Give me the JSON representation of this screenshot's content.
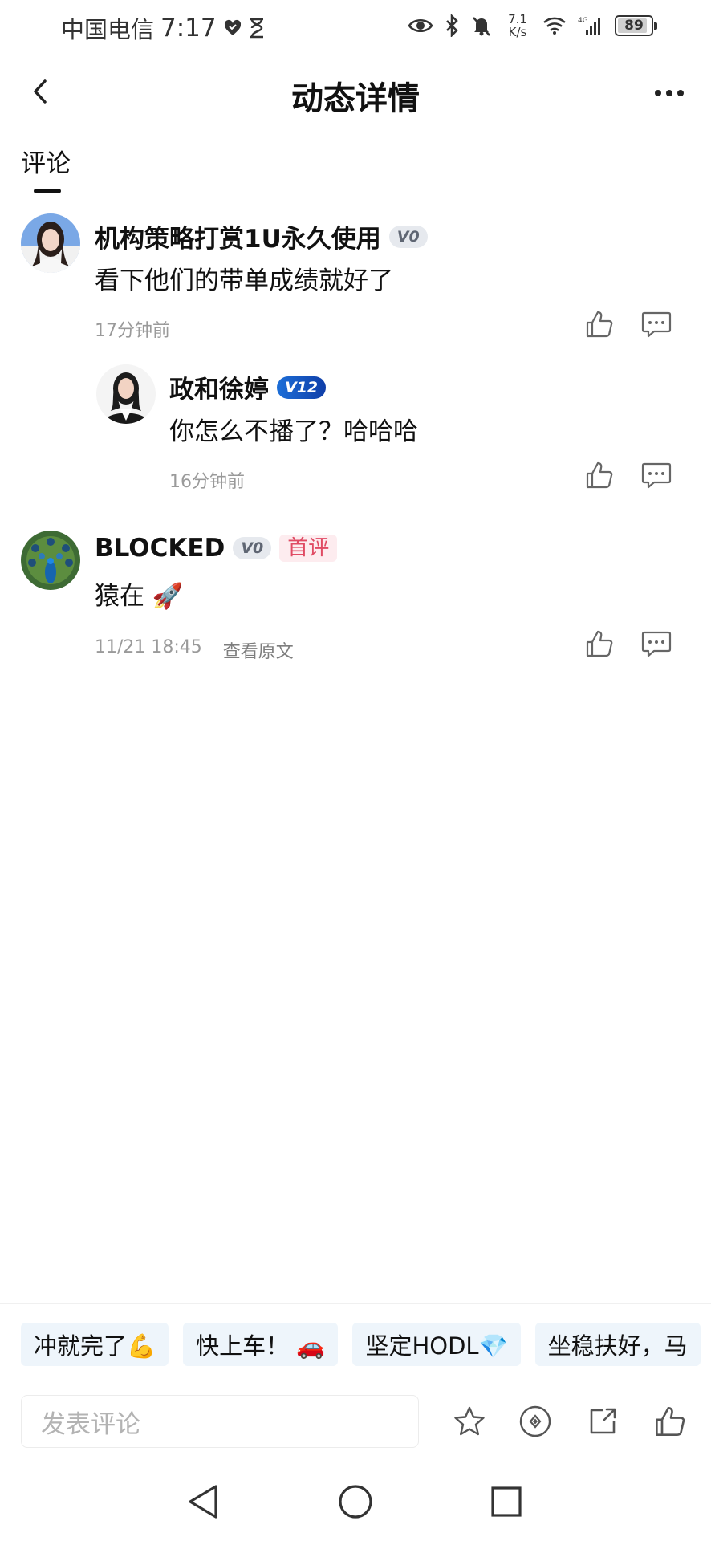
{
  "status_bar": {
    "carrier": "中国电信",
    "time": "7:17",
    "net_speed_value": "7.1",
    "net_speed_unit": "K/s",
    "battery_level": "89",
    "battery_fraction": 0.89
  },
  "header": {
    "title": "动态详情"
  },
  "tabs": {
    "comments": "评论"
  },
  "comments": [
    {
      "username": "机构策略打赏1U永久使用",
      "badge": "V0",
      "text": "看下他们的带单成绩就好了",
      "time": "17分钟前",
      "avatar": "woman-portrait-avatar"
    },
    {
      "username": "政和徐婷",
      "badge": "V12",
      "text": "你怎么不播了？哈哈哈",
      "time": "16分钟前",
      "avatar": "woman-suit-avatar"
    },
    {
      "username": "BLOCKED",
      "badge": "V0",
      "first_tag": "首评",
      "text": "猿在 🚀",
      "time": "11/21 18:45",
      "view_original": "查看原文",
      "avatar": "peacock-avatar"
    }
  ],
  "quick_replies": [
    "冲就完了💪",
    "快上车！ 🚗",
    "坚定HODL💎",
    "坐稳扶好，马"
  ],
  "bottom_bar": {
    "input_placeholder": "发表评论"
  },
  "colors": {
    "accent_red": "#e04a63",
    "badge_blue": "#1d6fd8",
    "quick_chip_bg": "#eef5fb"
  }
}
